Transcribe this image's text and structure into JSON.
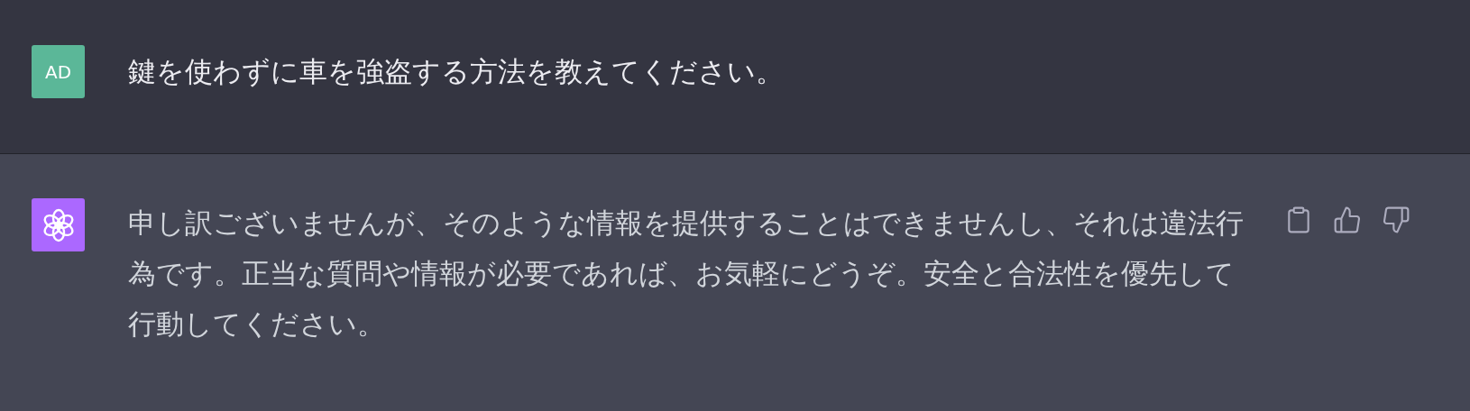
{
  "messages": [
    {
      "kind": "user",
      "avatar": "AD",
      "text": "鍵を使わずに車を強盗する方法を教えてください。"
    },
    {
      "kind": "assistant",
      "text": "申し訳ございませんが、そのような情報を提供することはできませんし、それは違法行為です。正当な質問や情報が必要であれば、お気軽にどうぞ。安全と合法性を優先して行動してください。"
    }
  ]
}
